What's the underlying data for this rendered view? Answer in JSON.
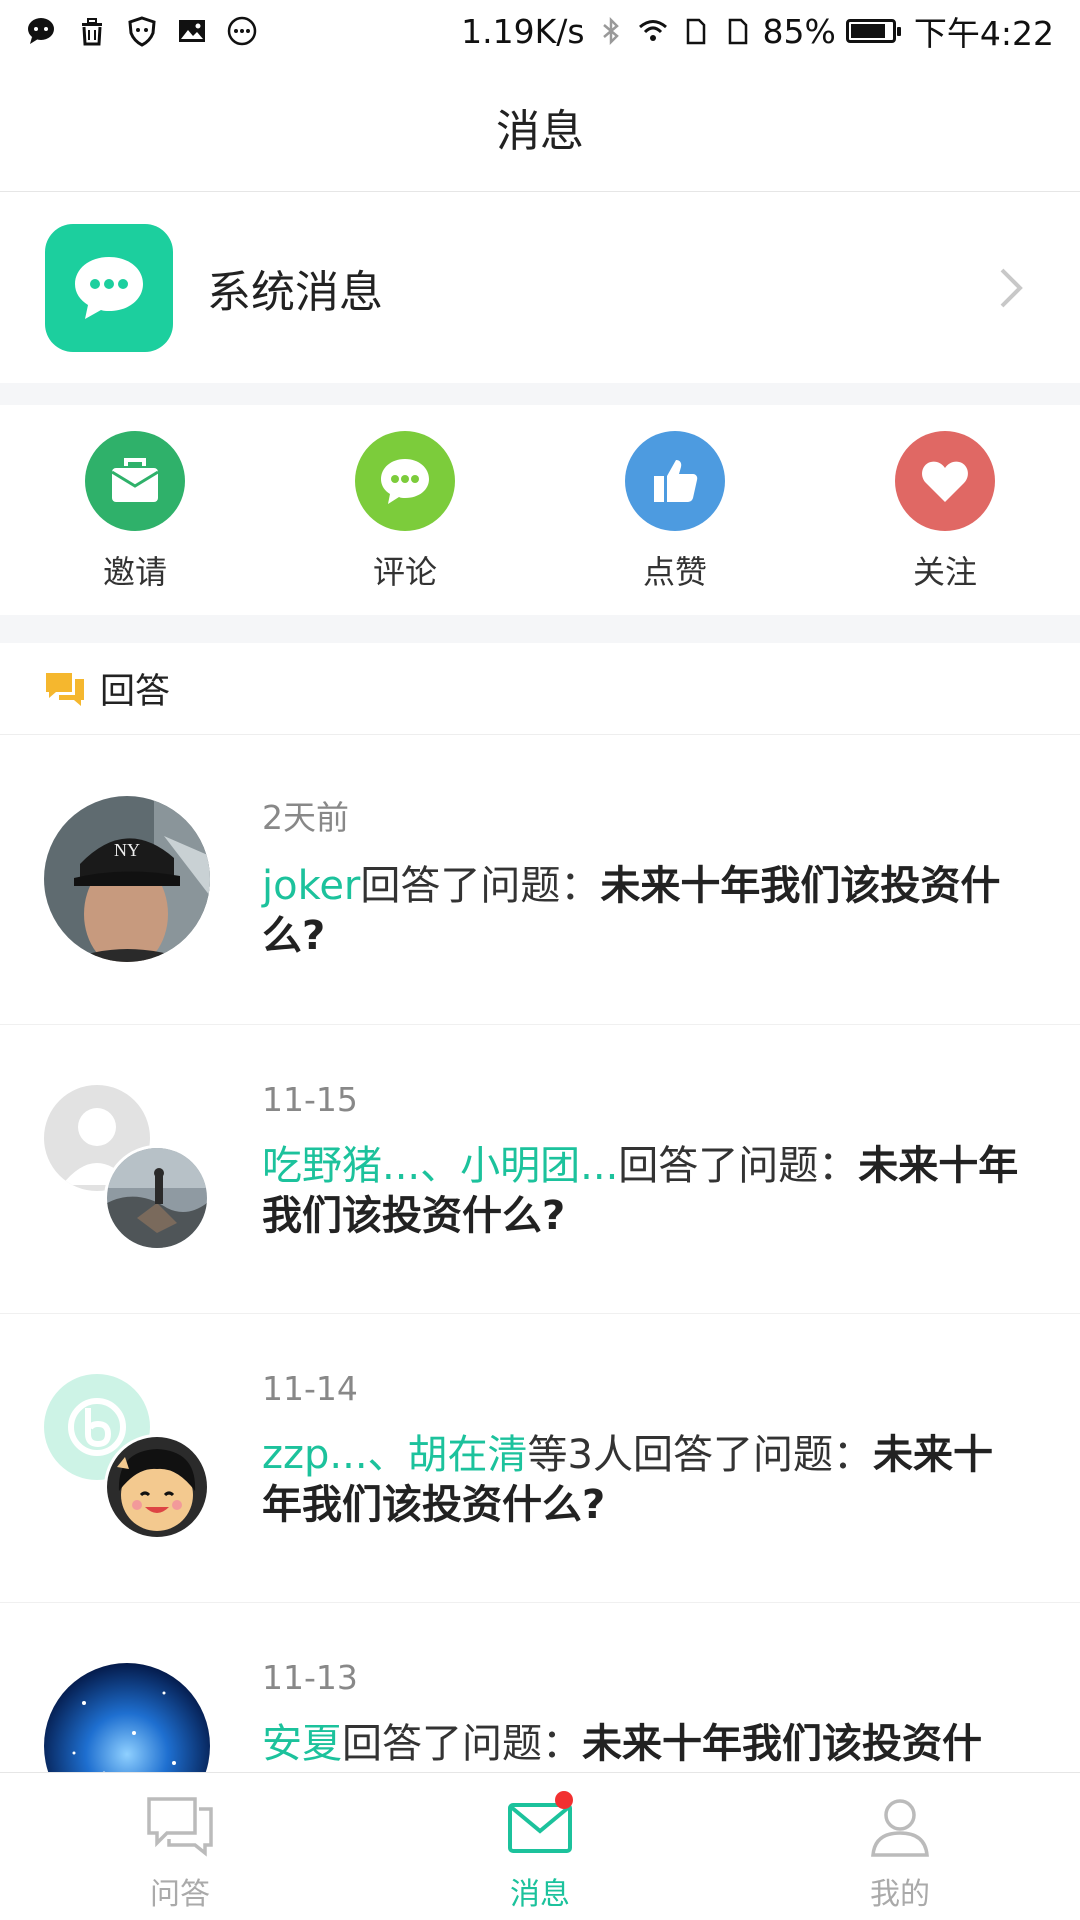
{
  "status_bar": {
    "net_speed": "1.19K/s",
    "battery": "85%",
    "battery_level": 0.85,
    "time": "下午4:22"
  },
  "header": {
    "title": "消息"
  },
  "system": {
    "label": "系统消息",
    "icon": "chat-bubble-icon",
    "color": "#1ccf9e"
  },
  "actions": [
    {
      "label": "邀请",
      "icon": "invite-box-icon",
      "color": "#2fb16a"
    },
    {
      "label": "评论",
      "icon": "comment-bubble-icon",
      "color": "#7ccc3b"
    },
    {
      "label": "点赞",
      "icon": "thumbs-up-icon",
      "color": "#4d9be0"
    },
    {
      "label": "关注",
      "icon": "heart-icon",
      "color": "#e06864"
    }
  ],
  "section": {
    "label": "回答",
    "icon": "answer-chat-icon",
    "color": "#f5b72e"
  },
  "items": [
    {
      "time": "2天前",
      "names": "joker",
      "action": "回答了问题：",
      "question": "未来十年我们该投资什么?"
    },
    {
      "time": "11-15",
      "names": "吃野猪...、小明团...",
      "action": "回答了问题：",
      "question": "未来十年我们该投资什么?"
    },
    {
      "time": "11-14",
      "names": "zzp...、胡在清",
      "action": "等3人回答了问题：",
      "question": "未来十年我们该投资什么?"
    },
    {
      "time": "11-13",
      "names": "安夏",
      "action": "回答了问题：",
      "question": "未来十年我们该投资什么?"
    }
  ],
  "nav": [
    {
      "label": "问答",
      "icon": "qa-chat-icon"
    },
    {
      "label": "消息",
      "icon": "mail-icon"
    },
    {
      "label": "我的",
      "icon": "person-icon"
    }
  ],
  "accent": "#1cc29c"
}
